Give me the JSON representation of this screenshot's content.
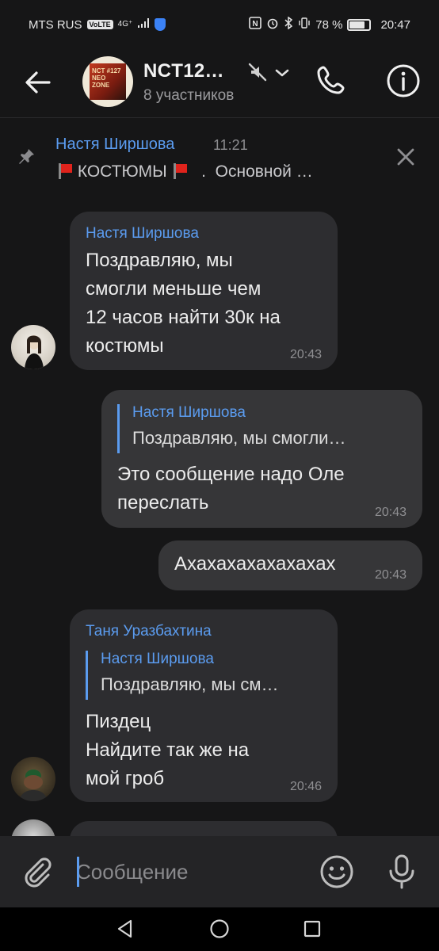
{
  "status_bar": {
    "carrier": "MTS RUS",
    "volte": "VoLTE",
    "network": "4G⁺",
    "battery_percent": "78 %",
    "battery_level": 0.78,
    "time": "20:47"
  },
  "header": {
    "title": "NCT12…",
    "subtitle": "8 участников",
    "avatar_text": "NCT #127 NEO ZONE"
  },
  "pinned": {
    "author": "Настя Ширшова",
    "time": "11:21",
    "text_a": "КОСТЮМЫ",
    "text_b": "  .  Основной …"
  },
  "messages": [
    {
      "author": "Настя Ширшова",
      "lines": [
        "Поздравляю, мы",
        "смогли меньше чем",
        "12 часов найти 30к на",
        "костюмы"
      ],
      "time": "20:43"
    },
    {
      "reply_author": "Настя Ширшова",
      "reply_text": "Поздравляю, мы смогли…",
      "lines": [
        "Это сообщение надо Оле",
        "переслать"
      ],
      "time": "20:43"
    },
    {
      "text": "Ахахахахахахахах",
      "time": "20:43"
    },
    {
      "author": "Таня Уразбахтина",
      "reply_author": "Настя Ширшова",
      "reply_text": "Поздравляю, мы см…",
      "lines": [
        "Пиздец",
        "Найдите так же на",
        "мой гроб"
      ],
      "time": "20:46"
    }
  ],
  "composer": {
    "placeholder": "Сообщение",
    "value": ""
  },
  "colors": {
    "accent": "#5b9cf0",
    "background": "#161617",
    "bubble_in": "#2d2d30",
    "bubble_out": "#363638"
  }
}
